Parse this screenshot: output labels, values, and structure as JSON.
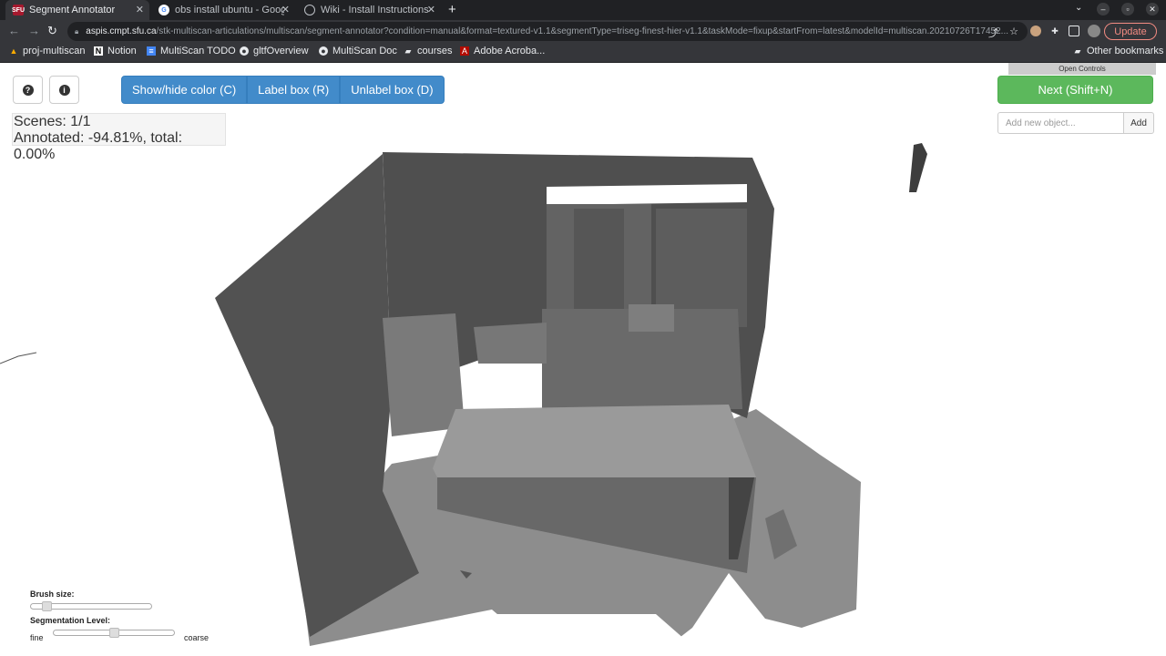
{
  "browser": {
    "tabs": [
      {
        "title": "Segment Annotator",
        "favicon": "SFU",
        "active": true
      },
      {
        "title": "obs install ubuntu - Goog",
        "favicon": "G",
        "active": false
      },
      {
        "title": "Wiki - Install Instructions",
        "favicon": "globe-icon",
        "active": false
      }
    ],
    "new_tab": "+",
    "url_host": "aspis.cmpt.sfu.ca",
    "url_path": "/stk-multiscan-articulations/multiscan/segment-annotator?condition=manual&format=textured-v1.1&segmentType=triseg-finest-hier-v1.1&taskMode=fixup&startFrom=latest&modelId=multiscan.20210726T17452...",
    "update_label": "Update",
    "bookmarks": [
      "proj-multiscan",
      "Notion",
      "MultiScan TODO",
      "gltfOverview",
      "MultiScan Doc",
      "courses",
      "Adobe Acroba..."
    ],
    "other_bookmarks": "Other bookmarks"
  },
  "app": {
    "help_icon": "?",
    "info_icon": "i",
    "buttons": {
      "show_hide_color": "Show/hide color (C)",
      "label_box": "Label box (R)",
      "unlabel_box": "Unlabel box (D)"
    },
    "stats": {
      "scenes": "Scenes: 1/1",
      "annotated": "Annotated: -94.81%, total: 0.00%"
    },
    "open_controls": "Open Controls",
    "next_button": "Next (Shift+N)",
    "new_object_placeholder": "Add new object...",
    "add_button": "Add",
    "brush_size_label": "Brush size:",
    "brush_size_value": 0.12,
    "segmentation_level_label": "Segmentation Level:",
    "segmentation_level_value": 0.5,
    "fine_label": "fine",
    "coarse_label": "coarse"
  },
  "colors": {
    "accent_blue": "#428bca",
    "next_green": "#5cb85c",
    "mesh_dark": "#4a4a4a",
    "mesh_light": "#8a8a8a"
  }
}
